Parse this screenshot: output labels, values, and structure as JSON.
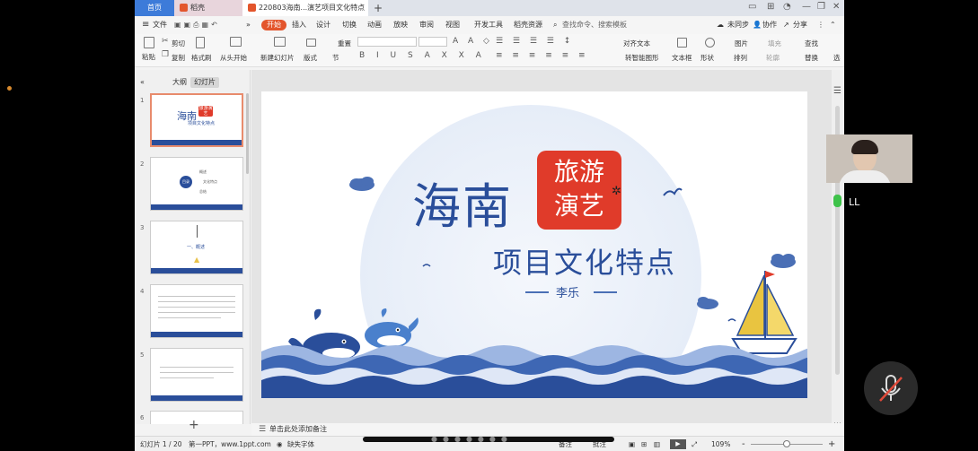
{
  "tabs": {
    "home": "首页",
    "daoke": "稻壳",
    "doc": "220803海南...演艺项目文化特点"
  },
  "menu": {
    "file": "文件",
    "start": "开始",
    "insert": "插入",
    "design": "设计",
    "transition": "切换",
    "animation": "动画",
    "slideshow": "放映",
    "review": "审阅",
    "view": "视图",
    "devtools": "开发工具",
    "resources": "稻壳资源",
    "search": "查找命令、搜索模板",
    "sync": "未同步",
    "collab": "协作",
    "share": "分享"
  },
  "toolbar": {
    "paste": "粘贴",
    "cut": "剪切",
    "copy": "复制",
    "format_painter": "格式刷",
    "play_from_start": "从头开始",
    "new_slide": "新建幻灯片",
    "layout": "版式",
    "section": "节",
    "reset": "重置",
    "text_dir": "对齐文本",
    "smart_art": "转智能图形",
    "textbox": "文本框",
    "shapes": "形状",
    "arrange": "排列",
    "picture": "图片",
    "fill": "填充",
    "outline": "轮廓",
    "find": "查找",
    "replace": "替换",
    "select": "选"
  },
  "panel": {
    "outline": "大纲",
    "slides": "幻灯片",
    "add": "+"
  },
  "thumbs": [
    {
      "num": "1",
      "title": "海南",
      "tag": "旅游演艺",
      "sub": "项目文化特点"
    },
    {
      "num": "2",
      "c1": "目录",
      "i1": "概述",
      "i2": "文化特点",
      "i3": "总结"
    },
    {
      "num": "3",
      "text": "一、概述"
    },
    {
      "num": "4"
    },
    {
      "num": "5"
    },
    {
      "num": "6"
    }
  ],
  "slide": {
    "title": "海南",
    "tag_line1": "旅游",
    "tag_line2": "演艺",
    "subtitle": "项目文化特点",
    "author": "李乐"
  },
  "notes": "单击此处添加备注",
  "status": {
    "slide": "幻灯片 1 / 20",
    "theme": "第一PPT，www.1ppt.com",
    "missing_font": "缺失字体",
    "comment": "备注",
    "notes_label": "批注",
    "zoom": "109%",
    "minus": "-",
    "plus": "+"
  },
  "video": {
    "name": "LL"
  },
  "colors": {
    "accent": "#e3552c",
    "primary": "#3d7bd9",
    "navy": "#2a4e9a",
    "red": "#e03b2a"
  }
}
